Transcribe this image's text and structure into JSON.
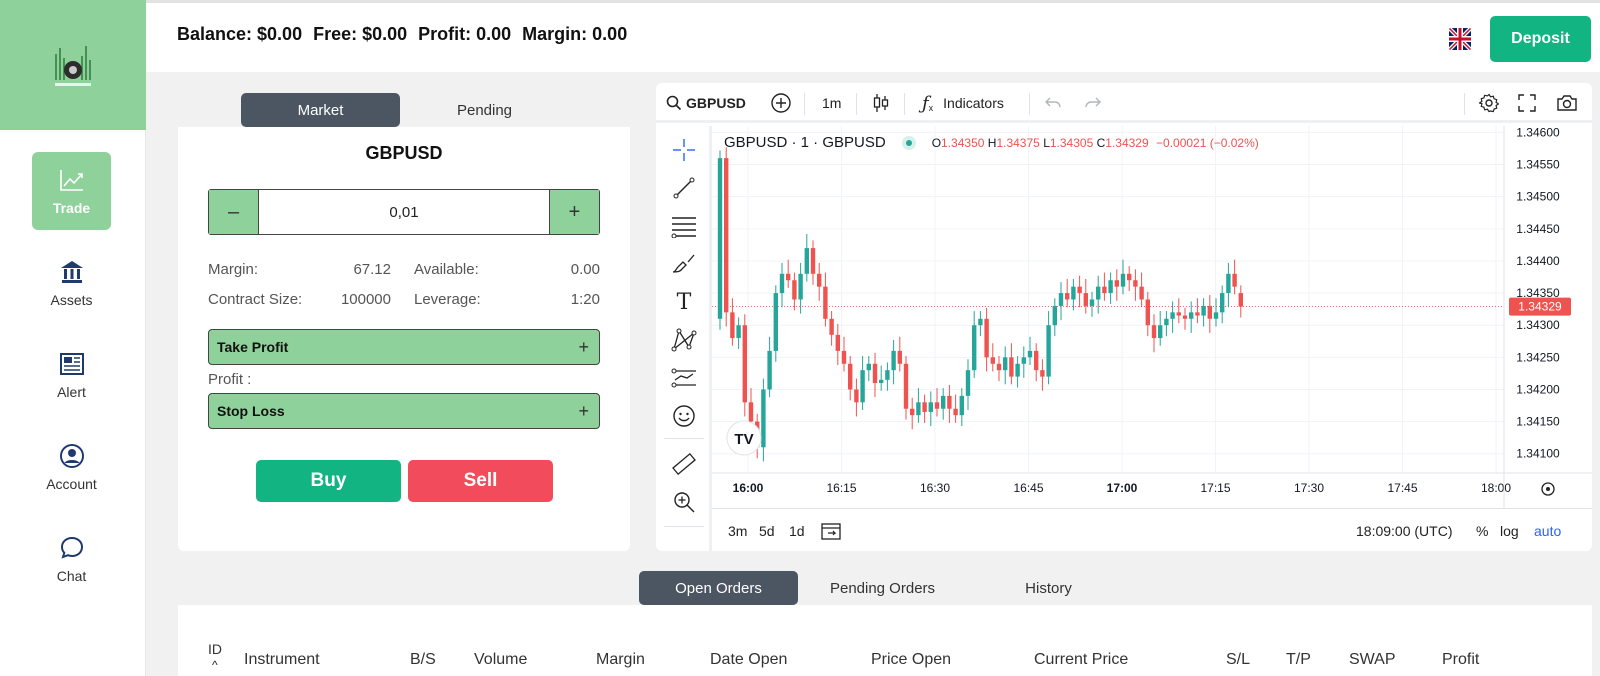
{
  "sidebar": {
    "items": [
      {
        "label": "Trade",
        "icon": "chart-trend-icon",
        "active": true
      },
      {
        "label": "Assets",
        "icon": "bank-icon",
        "active": false
      },
      {
        "label": "Alert",
        "icon": "newspaper-icon",
        "active": false
      },
      {
        "label": "Account",
        "icon": "user-icon",
        "active": false
      },
      {
        "label": "Chat",
        "icon": "chat-icon",
        "active": false
      }
    ]
  },
  "header": {
    "balance": "Balance: $0.00",
    "free": "Free: $0.00",
    "profit": "Profit: 0.00",
    "margin": "Margin: 0.00",
    "deposit_label": "Deposit"
  },
  "order_panel": {
    "tabs": [
      "Market",
      "Pending"
    ],
    "symbol": "GBPUSD",
    "quantity": "0,01",
    "minus": "–",
    "plus": "+",
    "margin_label": "Margin:",
    "margin_value": "67.12",
    "available_label": "Available:",
    "available_value": "0.00",
    "contract_label": "Contract Size:",
    "contract_value": "100000",
    "leverage_label": "Leverage:",
    "leverage_value": "1:20",
    "take_profit": "Take Profit",
    "profit_label": "Profit :",
    "stop_loss": "Stop Loss",
    "buy": "Buy",
    "sell": "Sell"
  },
  "chart": {
    "toolbar": {
      "symbol": "GBPUSD",
      "interval": "1m",
      "indicators": "Indicators"
    },
    "legend": {
      "title": "GBPUSD · 1 · GBPUSD",
      "o_label": "O",
      "o": "1.34350",
      "h_label": "H",
      "h": "1.34375",
      "l_label": "L",
      "l": "1.34305",
      "c_label": "C",
      "c": "1.34329",
      "change": "−0.00021 (−0.02%)"
    },
    "last_price": "1.34329",
    "ranges": [
      "3m",
      "5d",
      "1d"
    ],
    "clock": "18:09:00 (UTC)",
    "pct": "%",
    "log": "log",
    "auto": "auto",
    "colors": {
      "up": "#26a69a",
      "down": "#ef5350",
      "auto": "#2962ff"
    }
  },
  "chart_data": {
    "type": "candlestick",
    "y_ticks": [
      "1.34600",
      "1.34550",
      "1.34500",
      "1.34450",
      "1.34400",
      "1.34350",
      "1.34300",
      "1.34250",
      "1.34200",
      "1.34150",
      "1.34100"
    ],
    "x_ticks": [
      "16:00",
      "16:15",
      "16:30",
      "16:45",
      "17:00",
      "17:15",
      "17:30",
      "17:45",
      "18:00"
    ],
    "ylim": [
      1.3407,
      1.3461
    ],
    "closes": [
      1.3456,
      1.3432,
      1.3428,
      1.343,
      1.3418,
      1.3415,
      1.3411,
      1.342,
      1.3426,
      1.3435,
      1.3438,
      1.3437,
      1.3434,
      1.3438,
      1.3442,
      1.3438,
      1.3436,
      1.3431,
      1.34285,
      1.3426,
      1.3424,
      1.342,
      1.3418,
      1.3423,
      1.3424,
      1.3421,
      1.34215,
      1.3423,
      1.3426,
      1.3424,
      1.3417,
      1.3416,
      1.3418,
      1.34165,
      1.3418,
      1.3417,
      1.3419,
      1.3417,
      1.3416,
      1.3419,
      1.3423,
      1.343,
      1.3431,
      1.3425,
      1.3424,
      1.3423,
      1.3425,
      1.3422,
      1.3424,
      1.3425,
      1.3426,
      1.3423,
      1.3422,
      1.343,
      1.3433,
      1.3435,
      1.3434,
      1.3436,
      1.3435,
      1.3433,
      1.3434,
      1.3436,
      1.3435,
      1.3437,
      1.3436,
      1.3438,
      1.3437,
      1.3436,
      1.3434,
      1.343,
      1.3428,
      1.343,
      1.3431,
      1.3432,
      1.34315,
      1.3431,
      1.3432,
      1.34315,
      1.3433,
      1.3431,
      1.3432,
      1.3435,
      1.3438,
      1.3436,
      1.34329
    ],
    "opens": [
      1.3431,
      1.3456,
      1.3432,
      1.3428,
      1.343,
      1.3418,
      1.3415,
      1.3411,
      1.342,
      1.3426,
      1.3435,
      1.3438,
      1.3437,
      1.3434,
      1.3438,
      1.3442,
      1.3438,
      1.3436,
      1.3431,
      1.34285,
      1.3426,
      1.3424,
      1.342,
      1.3418,
      1.3423,
      1.3424,
      1.3421,
      1.34215,
      1.3423,
      1.3426,
      1.3424,
      1.3417,
      1.3416,
      1.3418,
      1.34165,
      1.3418,
      1.3417,
      1.3419,
      1.3417,
      1.3416,
      1.3419,
      1.3423,
      1.343,
      1.3431,
      1.3425,
      1.3424,
      1.3423,
      1.3425,
      1.3422,
      1.3424,
      1.3425,
      1.3426,
      1.3423,
      1.3422,
      1.343,
      1.3433,
      1.3435,
      1.3434,
      1.3436,
      1.3435,
      1.3433,
      1.3434,
      1.3436,
      1.3435,
      1.3437,
      1.3436,
      1.3438,
      1.3437,
      1.3436,
      1.3434,
      1.343,
      1.3428,
      1.343,
      1.3431,
      1.3432,
      1.34315,
      1.3431,
      1.3432,
      1.34315,
      1.3433,
      1.3431,
      1.3432,
      1.3435,
      1.3438,
      1.3435
    ]
  },
  "orders": {
    "tabs": [
      "Open Orders",
      "Pending Orders",
      "History"
    ],
    "columns": [
      "ID",
      "Instrument",
      "B/S",
      "Volume",
      "Margin",
      "Date Open",
      "Price Open",
      "Current Price",
      "S/L",
      "T/P",
      "SWAP",
      "Profit"
    ]
  }
}
